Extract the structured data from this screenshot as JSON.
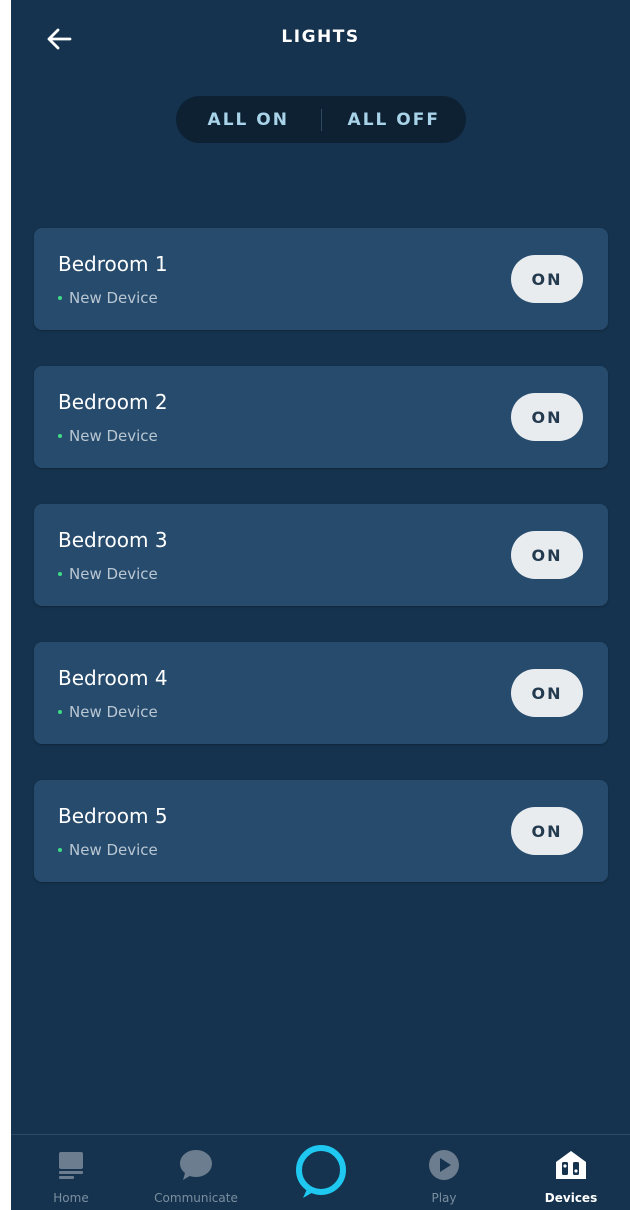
{
  "header": {
    "title": "LIGHTS",
    "back_icon": "arrow-left-icon"
  },
  "master": {
    "all_on": "ALL ON",
    "all_off": "ALL OFF"
  },
  "devices": [
    {
      "name": "Bedroom 1",
      "status": "New Device",
      "button": "ON"
    },
    {
      "name": "Bedroom 2",
      "status": "New Device",
      "button": "ON"
    },
    {
      "name": "Bedroom 3",
      "status": "New Device",
      "button": "ON"
    },
    {
      "name": "Bedroom 4",
      "status": "New Device",
      "button": "ON"
    },
    {
      "name": "Bedroom 5",
      "status": "New Device",
      "button": "ON"
    }
  ],
  "nav": {
    "home": {
      "label": "Home",
      "icon": "home-icon"
    },
    "communicate": {
      "label": "Communicate",
      "icon": "chat-bubble-icon"
    },
    "alexa": {
      "icon": "alexa-ring-icon"
    },
    "play": {
      "label": "Play",
      "icon": "play-icon"
    },
    "devices": {
      "label": "Devices",
      "icon": "devices-icon",
      "active": true
    }
  },
  "colors": {
    "background": "#15334e",
    "card": "#274b6d",
    "status_dot": "#3ddc84",
    "accent": "#1ec8f0",
    "toggle_text": "#a8d3e8"
  }
}
